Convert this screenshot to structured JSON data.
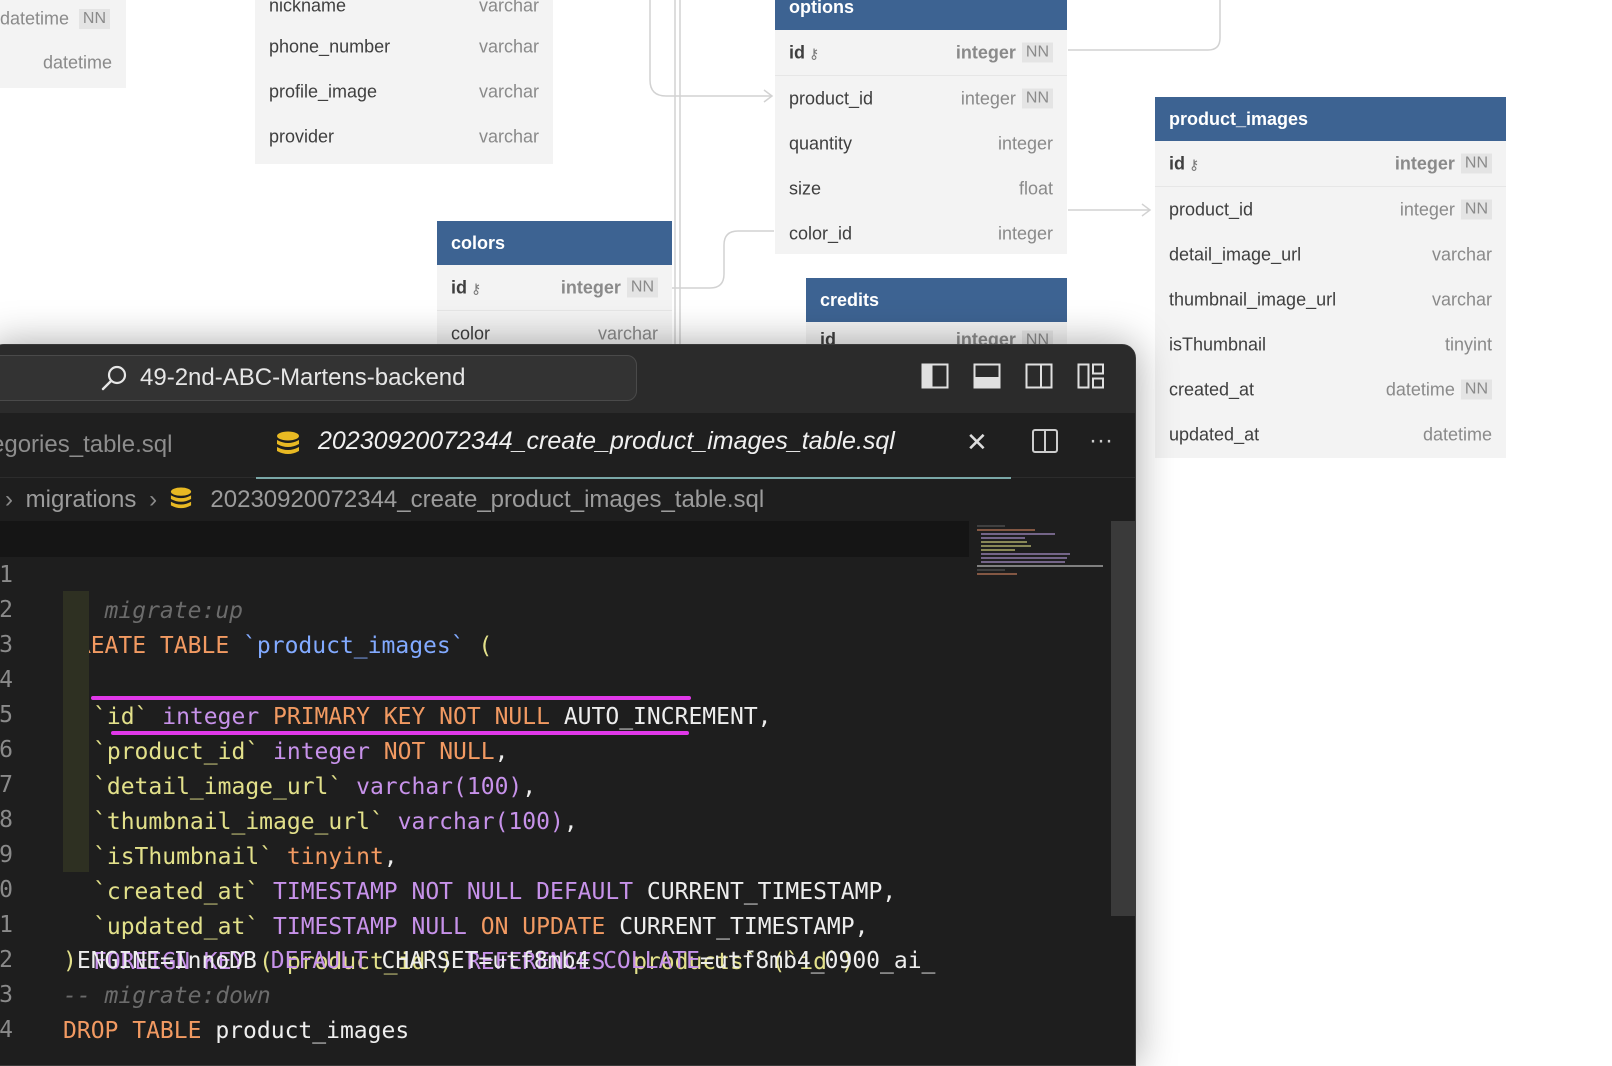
{
  "erd": {
    "left_table": {
      "rows": [
        {
          "name": "datetime",
          "type": "",
          "nn": "NN"
        },
        {
          "name": "",
          "type": "datetime",
          "nn": ""
        }
      ]
    },
    "users_table": {
      "rows": [
        {
          "name": "nickname",
          "type": "varchar"
        },
        {
          "name": "phone_number",
          "type": "varchar"
        },
        {
          "name": "profile_image",
          "type": "varchar"
        },
        {
          "name": "provider",
          "type": "varchar"
        }
      ]
    },
    "options": {
      "title": "options",
      "rows": [
        {
          "name": "id",
          "type": "integer",
          "nn": "NN",
          "pk": true
        },
        {
          "name": "product_id",
          "type": "integer",
          "nn": "NN"
        },
        {
          "name": "quantity",
          "type": "integer"
        },
        {
          "name": "size",
          "type": "float"
        },
        {
          "name": "color_id",
          "type": "integer"
        }
      ]
    },
    "colors": {
      "title": "colors",
      "rows": [
        {
          "name": "id",
          "type": "integer",
          "nn": "NN",
          "pk": true
        },
        {
          "name": "color",
          "type": "varchar"
        }
      ]
    },
    "credits": {
      "title": "credits",
      "rows": [
        {
          "name": "id",
          "type": "integer",
          "nn": "NN",
          "pk": true
        }
      ]
    },
    "product_images": {
      "title": "product_images",
      "rows": [
        {
          "name": "id",
          "type": "integer",
          "nn": "NN",
          "pk": true
        },
        {
          "name": "product_id",
          "type": "integer",
          "nn": "NN"
        },
        {
          "name": "detail_image_url",
          "type": "varchar"
        },
        {
          "name": "thumbnail_image_url",
          "type": "varchar"
        },
        {
          "name": "isThumbnail",
          "type": "tinyint"
        },
        {
          "name": "created_at",
          "type": "datetime",
          "nn": "NN"
        },
        {
          "name": "updated_at",
          "type": "datetime"
        }
      ]
    }
  },
  "editor": {
    "search_text": "49-2nd-ABC-Martens-backend",
    "inactive_tab": "egories_table.sql",
    "active_tab": "20230920072344_create_product_images_table.sql",
    "breadcrumb_folder": "migrations",
    "breadcrumb_file": "20230920072344_create_product_images_table.sql",
    "line_numbers": [
      "1",
      "2",
      "3",
      "4",
      "5",
      "6",
      "7",
      "8",
      "9",
      "0",
      "1",
      "2",
      "3",
      "4"
    ],
    "code": {
      "l1": "-- migrate:up",
      "l2a": "CREATE TABLE",
      "l2b": "`product_images`",
      "l2c": " (",
      "l3a": "`id`",
      "l3b": " integer",
      "l3c": " PRIMARY KEY NOT NULL",
      "l3d": " AUTO_INCREMENT,",
      "l4a": "`product_id`",
      "l4b": " integer",
      "l4c": " NOT NULL",
      "l4d": ",",
      "l5a": "`detail_image_url`",
      "l5b": " varchar(100)",
      "l5c": ",",
      "l6a": "`thumbnail_image_url`",
      "l6b": " varchar(100)",
      "l6c": ",",
      "l7a": "`isThumbnail`",
      "l7b": " tinyint",
      "l7c": ",",
      "l8a": "`created_at`",
      "l8b": " TIMESTAMP NOT NULL",
      "l8c": " DEFAULT",
      "l8d": " CURRENT_TIMESTAMP,",
      "l9a": "`updated_at`",
      "l9b": " TIMESTAMP NULL",
      "l9c": " ON UPDATE",
      "l9d": " CURRENT_TIMESTAMP,",
      "l10a": "FOREIGN KEY",
      "l10b": " (`product_id`)",
      "l10c": " REFERENCES",
      "l10d": " `products`",
      "l10e": " (`id`)",
      "l11a": ")",
      "l11b": "ENGINE=InnoDB",
      "l11c": " DEFAULT",
      "l11d": " CHARSET=utf8mb4",
      "l11e": " COLLATE",
      "l11f": "=utf8mb4_0900_ai_",
      "l12": "-- migrate:down",
      "l13a": "DROP TABLE",
      "l13b": " product_images"
    }
  }
}
